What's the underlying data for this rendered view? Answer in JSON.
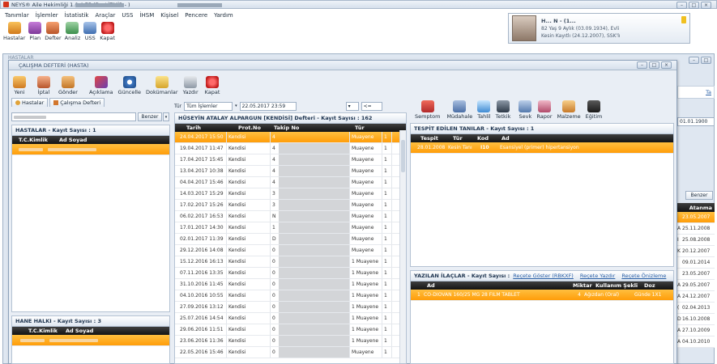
{
  "window_title": "NEYS® Aile Hekimliği 1.0.4.75 (Dr.  / İZMİR  -  )",
  "menu": [
    "Tanımlar",
    "İşlemler",
    "İstatistik",
    "Araçlar",
    "USS",
    "İHSM",
    "Kişisel",
    "Pencere",
    "Yardım"
  ],
  "main_toolbar": [
    "Hastalar",
    "Plan",
    "Defter",
    "Analiz",
    "USS",
    "Kapat"
  ],
  "patient_card": {
    "name": "H... N - (1...",
    "line1": "82 Yaş 9 Aylık (03.09.1934), Evli",
    "line2": "Kesin Kayıtlı (24.12.2007), SSK'lı"
  },
  "bg_window": {
    "title": "HASTALAR",
    "input_label": "Benzer",
    "col_header": "Atanma",
    "dates": [
      "23.05.2007",
      "25.11.2008",
      "25.08.2008",
      "20.12.2007",
      "09.01.2014",
      "23.05.2007",
      "29.05.2007",
      "24.12.2007",
      "02.04.2013",
      "16.10.2008",
      "27.10.2009",
      "04.10.2010"
    ],
    "prefixes": [
      "",
      "A",
      "I",
      "K",
      "",
      "",
      "A",
      "A",
      "(",
      "D",
      "A",
      "A"
    ],
    "top_date": "01.01.1900",
    "tab_label": "Ta"
  },
  "cal_window": {
    "title": "ÇALIŞMA DEFTERİ (HASTA)"
  },
  "toolbar": [
    "Yeni",
    "İptal",
    "Gönder",
    "Açıklama",
    "Güncelle",
    "Dokümanlar",
    "Yazdır",
    "Kapat"
  ],
  "tabs": {
    "hastalar": "Hastalar",
    "calisma": "Çalışma Defteri"
  },
  "search_benzer": "Benzer",
  "hastalar_panel": {
    "title": "HASTALAR - Kayıt Sayısı : 1",
    "col_tc": "T.C.Kimlik",
    "col_ad": "Ad Soyad"
  },
  "hane_panel": {
    "title": "HANE HALKI - Kayıt Sayısı : 3",
    "col_tc": "T.C.Kimlik",
    "col_ad": "Ad Soyad"
  },
  "filter": {
    "tur": "Tür",
    "value": "Tüm İşlemler",
    "date": "22.05.2017 23:59",
    "dir": "<="
  },
  "defter": {
    "title": "HÜSEYİN ATALAY ALPARGUN [KENDİSİ] Defteri - Kayıt Sayısı : 162",
    "headers": [
      "Tarih",
      "Prot.No",
      "Takip No",
      "Tür"
    ],
    "rows": [
      [
        "24.04.2017 15:50",
        "Kendisi",
        "4",
        "Muayene",
        "1"
      ],
      [
        "19.04.2017 11:47",
        "Kendisi",
        "4",
        "Muayene",
        "1"
      ],
      [
        "17.04.2017 15:45",
        "Kendisi",
        "4",
        "Muayene",
        "1"
      ],
      [
        "13.04.2017 10:38",
        "Kendisi",
        "4",
        "Muayene",
        "1"
      ],
      [
        "04.04.2017 15:46",
        "Kendisi",
        "4",
        "Muayene",
        "1"
      ],
      [
        "14.03.2017 15:29",
        "Kendisi",
        "3",
        "Muayene",
        "1"
      ],
      [
        "17.02.2017 15:26",
        "Kendisi",
        "3",
        "Muayene",
        "1"
      ],
      [
        "06.02.2017 16:53",
        "Kendisi",
        "N",
        "Muayene",
        "1"
      ],
      [
        "17.01.2017 14:30",
        "Kendisi",
        "1",
        "Muayene",
        "1"
      ],
      [
        "02.01.2017 11:39",
        "Kendisi",
        "D",
        "Muayene",
        "1"
      ],
      [
        "29.12.2016 14:08",
        "Kendisi",
        "0",
        "Muayene",
        "1"
      ],
      [
        "15.12.2016 16:13",
        "Kendisi",
        "0",
        "1 Muayene",
        "1"
      ],
      [
        "07.11.2016 13:35",
        "Kendisi",
        "0",
        "1 Muayene",
        "1"
      ],
      [
        "31.10.2016 11:45",
        "Kendisi",
        "0",
        "1 Muayene",
        "1"
      ],
      [
        "04.10.2016 10:55",
        "Kendisi",
        "0",
        "1 Muayene",
        "1"
      ],
      [
        "27.09.2016 13:12",
        "Kendisi",
        "0",
        "1 Muayene",
        "1"
      ],
      [
        "25.07.2016 14:54",
        "Kendisi",
        "0",
        "1 Muayene",
        "1"
      ],
      [
        "29.06.2016 11:51",
        "Kendisi",
        "0",
        "1 Muayene",
        "1"
      ],
      [
        "23.06.2016 11:36",
        "Kendisi",
        "0",
        "1 Muayene",
        "1"
      ],
      [
        "22.05.2016 15:46",
        "Kendisi",
        "0",
        "Muayene",
        "1"
      ]
    ]
  },
  "right_toolbar": [
    "Semptom",
    "Müdahale",
    "Tahlil",
    "Tetkik",
    "Sevk",
    "Rapor",
    "Malzeme",
    "Eğitim"
  ],
  "tanilar": {
    "title": "TESPİT EDİLEN TANILAR - Kayıt Sayısı : 1",
    "headers": [
      "Tespit",
      "Tür",
      "Kod",
      "Ad"
    ],
    "row": [
      "28.01.2008",
      "Kesin Tanı",
      "I10",
      "Esansiyel (primer) hipertansiyon"
    ]
  },
  "ilaclar": {
    "title": "YAZILAN İLAÇLAR - Kayıt Sayısı :",
    "link1": "Reçete Göster (RBKXF)",
    "link2": "Reçete Yazdır",
    "link3": "Reçete Önizleme",
    "headers": [
      "Ad",
      "Miktar",
      "Kullanım Şekli",
      "Doz"
    ],
    "row": [
      "1",
      "CO-DIOVAN 160/25 MG 28 FILM TABLET",
      "4",
      "Ağızdan (Oral)",
      "Günde 1X1"
    ]
  },
  "colors": {
    "selection": "#ff9d0a",
    "accent": "#2f5b8a"
  }
}
